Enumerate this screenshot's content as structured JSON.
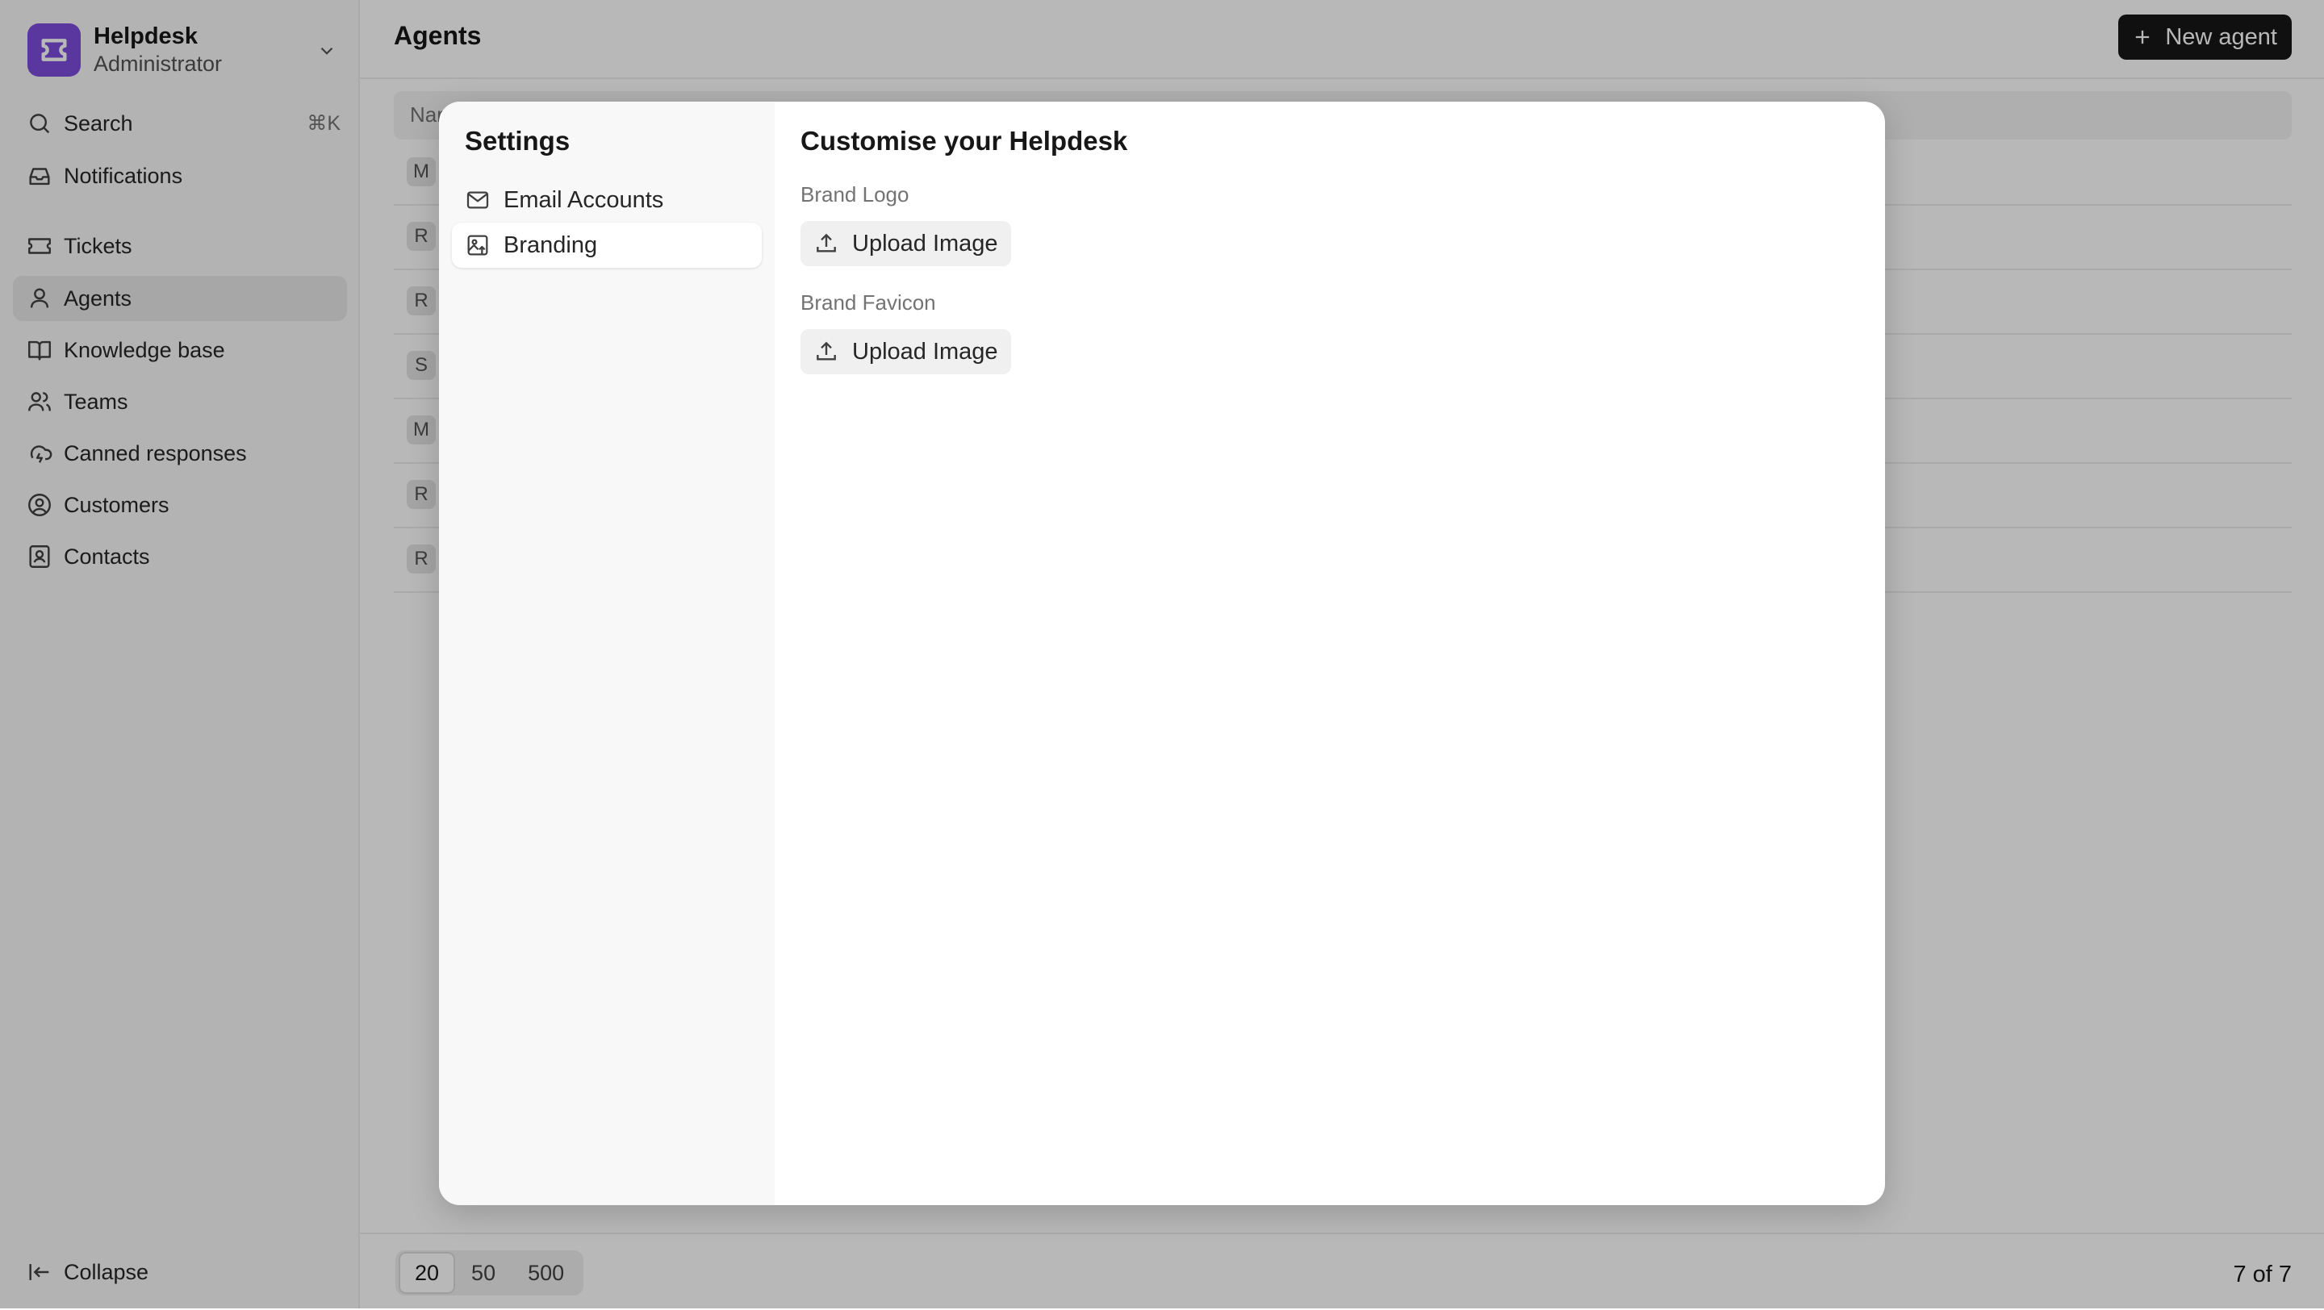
{
  "app": {
    "name": "Helpdesk",
    "role": "Administrator",
    "brand_color": "#7c4ddc"
  },
  "sidebar": {
    "search": {
      "label": "Search",
      "shortcut": "⌘K"
    },
    "items": [
      {
        "label": "Notifications",
        "icon": "inbox-icon"
      },
      {
        "label": "Tickets",
        "icon": "ticket-icon"
      },
      {
        "label": "Agents",
        "icon": "user-icon",
        "active": true
      },
      {
        "label": "Knowledge base",
        "icon": "book-icon"
      },
      {
        "label": "Teams",
        "icon": "users-icon"
      },
      {
        "label": "Canned responses",
        "icon": "cloud-lightning-icon"
      },
      {
        "label": "Customers",
        "icon": "user-circle-icon"
      },
      {
        "label": "Contacts",
        "icon": "contact-icon"
      }
    ],
    "collapse_label": "Collapse"
  },
  "header": {
    "title": "Agents",
    "new_button": "New agent"
  },
  "table": {
    "header_label": "Nar",
    "rows": [
      "M",
      "R",
      "R",
      "S",
      "M",
      "R",
      "R"
    ]
  },
  "footer": {
    "page_sizes": [
      "20",
      "50",
      "500"
    ],
    "selected": "20",
    "count": "7 of 7"
  },
  "modal": {
    "title": "Settings",
    "menu": [
      {
        "label": "Email Accounts",
        "icon": "mail-icon"
      },
      {
        "label": "Branding",
        "icon": "image-icon",
        "active": true
      }
    ],
    "heading": "Customise your Helpdesk",
    "fields": [
      {
        "label": "Brand Logo",
        "button": "Upload Image"
      },
      {
        "label": "Brand Favicon",
        "button": "Upload Image"
      }
    ]
  }
}
